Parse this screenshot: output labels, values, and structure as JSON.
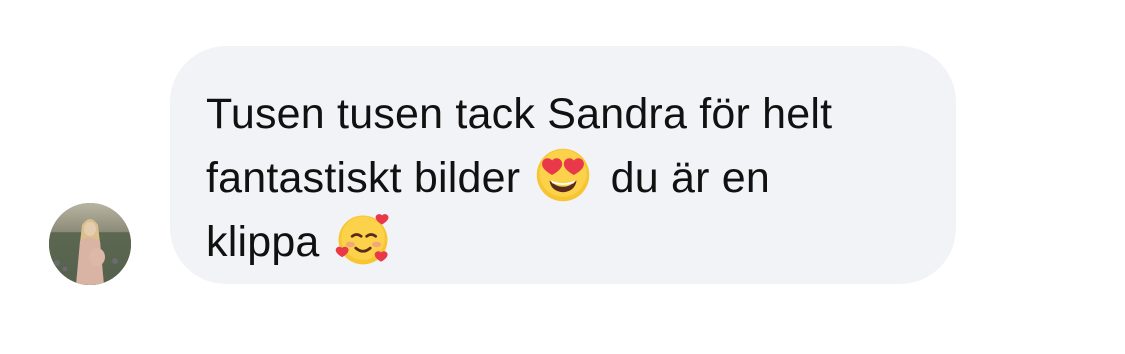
{
  "message": {
    "line1": "Tusen tusen tack Sandra för helt",
    "line2_before": "fantastiskt bilder ",
    "line2_after": " du är en",
    "line3": "klippa ",
    "emojis": [
      "heart-eyes-face",
      "smiling-face-with-hearts"
    ]
  },
  "colors": {
    "bubble": "#f2f3f6",
    "text": "#111111",
    "emoji_face": "#f7c531",
    "heart": "#e8384a"
  }
}
